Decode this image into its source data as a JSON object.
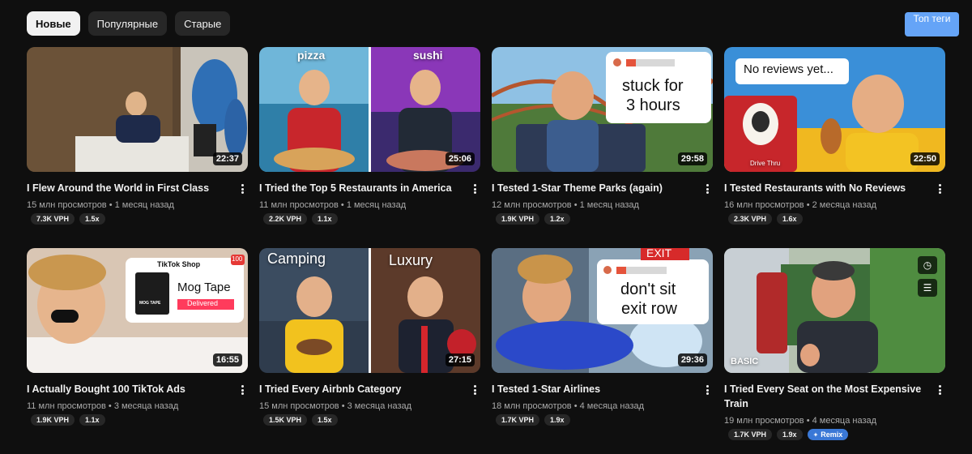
{
  "filters": {
    "chips": [
      "Новые",
      "Популярные",
      "Старые"
    ],
    "active": "Новые",
    "top_tags": "Топ теги"
  },
  "videos": [
    {
      "title": "I Flew Around the World in First Class",
      "views": "15 млн просмотров",
      "age": "1 месяц назад",
      "vph": "7.3K VPH",
      "ratio": "1.5x",
      "duration": "22:37"
    },
    {
      "title": "I Tried the Top 5 Restaurants in America",
      "views": "11 млн просмотров",
      "age": "1 месяц назад",
      "vph": "2.2K VPH",
      "ratio": "1.1x",
      "duration": "25:06",
      "overlay": [
        "pizza",
        "sushi"
      ]
    },
    {
      "title": "I Tested 1-Star Theme Parks (again)",
      "views": "12 млн просмотров",
      "age": "1 месяц назад",
      "vph": "1.9K VPH",
      "ratio": "1.2x",
      "duration": "29:58",
      "overlay": [
        "stuck for",
        "3 hours"
      ]
    },
    {
      "title": "I Tested Restaurants with No Reviews",
      "views": "16 млн просмотров",
      "age": "2 месяца назад",
      "vph": "2.3K VPH",
      "ratio": "1.6x",
      "duration": "22:50",
      "overlay": [
        "No reviews yet...",
        "Drive Thru"
      ]
    },
    {
      "title": "I Actually Bought 100 TikTok Ads",
      "views": "11 млн просмотров",
      "age": "3 месяца назад",
      "vph": "1.9K VPH",
      "ratio": "1.1x",
      "duration": "16:55",
      "overlay": [
        "TikTok Shop",
        "Mog Tape",
        "Delivered",
        "100",
        "MOG TAPE"
      ]
    },
    {
      "title": "I Tried Every Airbnb Category",
      "views": "15 млн просмотров",
      "age": "3 месяца назад",
      "vph": "1.5K VPH",
      "ratio": "1.5x",
      "duration": "27:15",
      "overlay": [
        "Camping",
        "Luxury"
      ]
    },
    {
      "title": "I Tested 1-Star Airlines",
      "views": "18 млн просмотров",
      "age": "4 месяца назад",
      "vph": "1.7K VPH",
      "ratio": "1.9x",
      "duration": "29:36",
      "overlay": [
        "EXIT",
        "don't sit",
        "exit row"
      ]
    },
    {
      "title": "I Tried Every Seat on the Most Expensive Train",
      "views": "19 млн просмотров",
      "age": "4 месяца назад",
      "vph": "1.7K VPH",
      "ratio": "1.9x",
      "remix": "Remix",
      "overlay": [
        "BASIC"
      ]
    }
  ],
  "colors": {
    "background": "#0f0f0f",
    "chip": "#272727",
    "accent": "#65a4f7",
    "remix": "#3a78d6"
  }
}
